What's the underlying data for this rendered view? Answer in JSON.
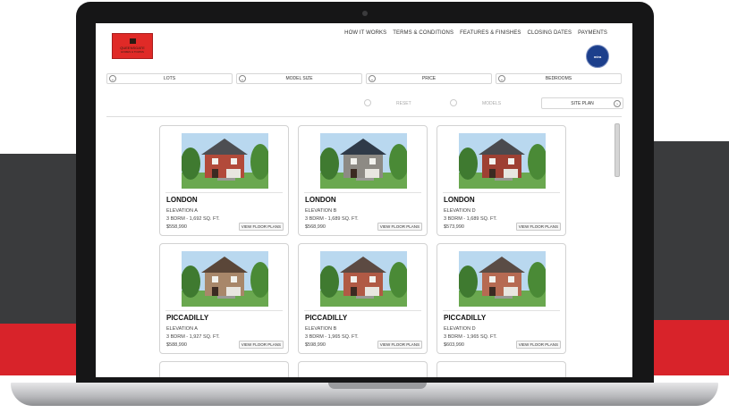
{
  "logo": {
    "line1": "QUEENSGATE",
    "line2": "HOMES & TOWNS"
  },
  "nav": [
    "HOW IT WORKS",
    "TERMS & CONDITIONS",
    "FEATURES & FINISHES",
    "CLOSING DATES",
    "PAYMENTS"
  ],
  "badge": {
    "text": "mira"
  },
  "filters": [
    "LOTS",
    "MODEL SIZE",
    "PRICE",
    "BEDROOMS"
  ],
  "actions": {
    "reset": "RESET",
    "models": "MODELS",
    "site_plan": "SITE PLAN"
  },
  "view_label": "VIEW FLOOR PLANS",
  "models": [
    {
      "name": "LONDON",
      "elevation": "ELEVATION A",
      "size": "3 BDRM - 1,692 SQ. FT.",
      "price": "$558,990",
      "house": "brick",
      "roof": "#4d4e52",
      "wall": "#b24a3a"
    },
    {
      "name": "LONDON",
      "elevation": "ELEVATION B",
      "size": "3 BDRM - 1,689 SQ. FT.",
      "price": "$568,990",
      "house": "stone",
      "roof": "#2f3a48",
      "wall": "#8d8a84"
    },
    {
      "name": "LONDON",
      "elevation": "ELEVATION D",
      "size": "3 BDRM - 1,689 SQ. FT.",
      "price": "$573,990",
      "house": "brick",
      "roof": "#4a4a4e",
      "wall": "#9e4033"
    },
    {
      "name": "PICCADILLY",
      "elevation": "ELEVATION A",
      "size": "3 BDRM - 1,927 SQ. FT.",
      "price": "$588,990",
      "house": "brown",
      "roof": "#5a4638",
      "wall": "#a8876a"
    },
    {
      "name": "PICCADILLY",
      "elevation": "ELEVATION B",
      "size": "3 BDRM - 1,965 SQ. FT.",
      "price": "$598,990",
      "house": "brick",
      "roof": "#5c4a42",
      "wall": "#b05a45"
    },
    {
      "name": "PICCADILLY",
      "elevation": "ELEVATION D",
      "size": "3 BDRM - 1,965 SQ. FT.",
      "price": "$603,990",
      "house": "brick",
      "roof": "#5a4c45",
      "wall": "#b66a52"
    }
  ]
}
